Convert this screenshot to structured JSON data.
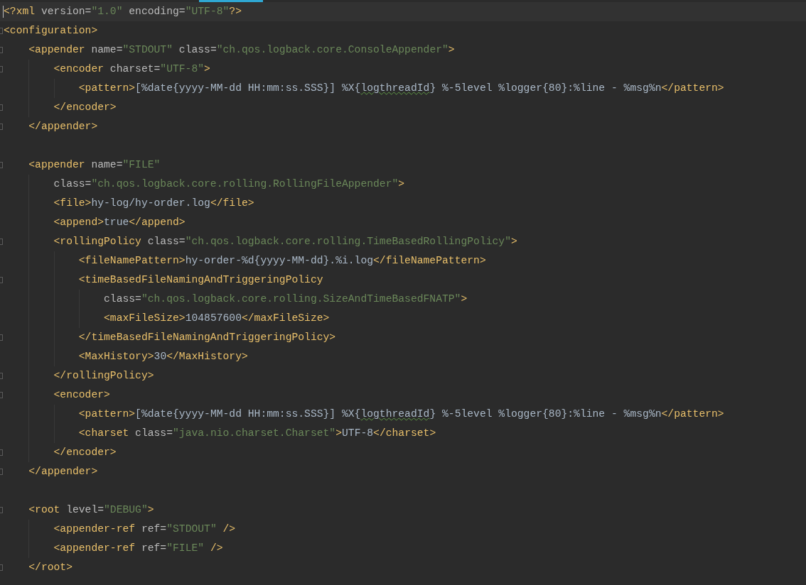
{
  "editor": {
    "lines": [
      {
        "current": true,
        "fold": false,
        "tokens": [
          {
            "kind": "tag",
            "text": "<?xml"
          },
          {
            "kind": "attr",
            "text": " version="
          },
          {
            "kind": "value",
            "text": "\"1.0\""
          },
          {
            "kind": "attr",
            "text": " encoding="
          },
          {
            "kind": "value",
            "text": "\"UTF-8\""
          },
          {
            "kind": "tag",
            "text": "?>"
          }
        ]
      },
      {
        "current": false,
        "fold": true,
        "tokens": [
          {
            "kind": "tag",
            "text": "<configuration>"
          }
        ]
      },
      {
        "current": false,
        "fold": true,
        "tokens": [
          {
            "kind": "tag",
            "text": "    <appender"
          },
          {
            "kind": "attr",
            "text": " name="
          },
          {
            "kind": "value",
            "text": "\"STDOUT\""
          },
          {
            "kind": "attr",
            "text": " class="
          },
          {
            "kind": "value",
            "text": "\"ch.qos.logback.core.ConsoleAppender\""
          },
          {
            "kind": "tag",
            "text": ">"
          }
        ]
      },
      {
        "current": false,
        "fold": true,
        "tokens": [
          {
            "kind": "tag",
            "text": "        <encoder"
          },
          {
            "kind": "attr",
            "text": " charset="
          },
          {
            "kind": "value",
            "text": "\"UTF-8\""
          },
          {
            "kind": "tag",
            "text": ">"
          }
        ]
      },
      {
        "current": false,
        "fold": false,
        "tokens": [
          {
            "kind": "tag",
            "text": "            <pattern>"
          },
          {
            "kind": "text",
            "text": "[%date{yyyy-MM-dd HH:mm:ss.SSS}] %X{"
          },
          {
            "kind": "typo",
            "text": "logthreadId"
          },
          {
            "kind": "text",
            "text": "} %-5level %logger{80}:%line - %msg%n"
          },
          {
            "kind": "tag",
            "text": "</pattern>"
          }
        ]
      },
      {
        "current": false,
        "fold": true,
        "tokens": [
          {
            "kind": "tag",
            "text": "        </encoder>"
          }
        ]
      },
      {
        "current": false,
        "fold": true,
        "tokens": [
          {
            "kind": "tag",
            "text": "    </appender>"
          }
        ]
      },
      {
        "current": false,
        "fold": false
      },
      {
        "current": false,
        "fold": true,
        "tokens": [
          {
            "kind": "tag",
            "text": "    <appender"
          },
          {
            "kind": "attr",
            "text": " name="
          },
          {
            "kind": "value",
            "text": "\"FILE\""
          }
        ]
      },
      {
        "current": false,
        "fold": false,
        "tokens": [
          {
            "kind": "attr",
            "text": "        class="
          },
          {
            "kind": "value",
            "text": "\"ch.qos.logback.core.rolling.RollingFileAppender\""
          },
          {
            "kind": "tag",
            "text": ">"
          }
        ]
      },
      {
        "current": false,
        "fold": false,
        "tokens": [
          {
            "kind": "tag",
            "text": "        <file>"
          },
          {
            "kind": "text",
            "text": "hy-log/hy-order.log"
          },
          {
            "kind": "tag",
            "text": "</file>"
          }
        ]
      },
      {
        "current": false,
        "fold": false,
        "tokens": [
          {
            "kind": "tag",
            "text": "        <append>"
          },
          {
            "kind": "text",
            "text": "true"
          },
          {
            "kind": "tag",
            "text": "</append>"
          }
        ]
      },
      {
        "current": false,
        "fold": true,
        "tokens": [
          {
            "kind": "tag",
            "text": "        <rollingPolicy"
          },
          {
            "kind": "attr",
            "text": " class="
          },
          {
            "kind": "value",
            "text": "\"ch.qos.logback.core.rolling.TimeBasedRollingPolicy\""
          },
          {
            "kind": "tag",
            "text": ">"
          }
        ]
      },
      {
        "current": false,
        "fold": false,
        "tokens": [
          {
            "kind": "tag",
            "text": "            <fileNamePattern>"
          },
          {
            "kind": "text",
            "text": "hy-order-%d{yyyy-MM-dd}.%i.log"
          },
          {
            "kind": "tag",
            "text": "</fileNamePattern>"
          }
        ]
      },
      {
        "current": false,
        "fold": true,
        "tokens": [
          {
            "kind": "tag",
            "text": "            <timeBasedFileNamingAndTriggeringPolicy"
          }
        ]
      },
      {
        "current": false,
        "fold": false,
        "tokens": [
          {
            "kind": "attr",
            "text": "                class="
          },
          {
            "kind": "value",
            "text": "\"ch.qos.logback.core.rolling.SizeAndTimeBasedFNATP\""
          },
          {
            "kind": "tag",
            "text": ">"
          }
        ]
      },
      {
        "current": false,
        "fold": false,
        "tokens": [
          {
            "kind": "tag",
            "text": "                <maxFileSize>"
          },
          {
            "kind": "text",
            "text": "104857600"
          },
          {
            "kind": "tag",
            "text": "</maxFileSize>"
          }
        ]
      },
      {
        "current": false,
        "fold": true,
        "tokens": [
          {
            "kind": "tag",
            "text": "            </timeBasedFileNamingAndTriggeringPolicy>"
          }
        ]
      },
      {
        "current": false,
        "fold": false,
        "tokens": [
          {
            "kind": "tag",
            "text": "            <MaxHistory>"
          },
          {
            "kind": "text",
            "text": "30"
          },
          {
            "kind": "tag",
            "text": "</MaxHistory>"
          }
        ]
      },
      {
        "current": false,
        "fold": true,
        "tokens": [
          {
            "kind": "tag",
            "text": "        </rollingPolicy>"
          }
        ]
      },
      {
        "current": false,
        "fold": true,
        "tokens": [
          {
            "kind": "tag",
            "text": "        <encoder>"
          }
        ]
      },
      {
        "current": false,
        "fold": false,
        "tokens": [
          {
            "kind": "tag",
            "text": "            <pattern>"
          },
          {
            "kind": "text",
            "text": "[%date{yyyy-MM-dd HH:mm:ss.SSS}] %X{"
          },
          {
            "kind": "typo",
            "text": "logthreadId"
          },
          {
            "kind": "text",
            "text": "} %-5level %logger{80}:%line - %msg%n"
          },
          {
            "kind": "tag",
            "text": "</pattern>"
          }
        ]
      },
      {
        "current": false,
        "fold": false,
        "tokens": [
          {
            "kind": "tag",
            "text": "            <charset"
          },
          {
            "kind": "attr",
            "text": " class="
          },
          {
            "kind": "value",
            "text": "\"java.nio.charset.Charset\""
          },
          {
            "kind": "tag",
            "text": ">"
          },
          {
            "kind": "text",
            "text": "UTF-8"
          },
          {
            "kind": "tag",
            "text": "</charset>"
          }
        ]
      },
      {
        "current": false,
        "fold": true,
        "tokens": [
          {
            "kind": "tag",
            "text": "        </encoder>"
          }
        ]
      },
      {
        "current": false,
        "fold": true,
        "tokens": [
          {
            "kind": "tag",
            "text": "    </appender>"
          }
        ]
      },
      {
        "current": false,
        "fold": false
      },
      {
        "current": false,
        "fold": true,
        "tokens": [
          {
            "kind": "tag",
            "text": "    <root"
          },
          {
            "kind": "attr",
            "text": " level="
          },
          {
            "kind": "value",
            "text": "\"DEBUG\""
          },
          {
            "kind": "tag",
            "text": ">"
          }
        ]
      },
      {
        "current": false,
        "fold": false,
        "tokens": [
          {
            "kind": "tag",
            "text": "        <appender-ref"
          },
          {
            "kind": "attr",
            "text": " ref="
          },
          {
            "kind": "value",
            "text": "\"STDOUT\""
          },
          {
            "kind": "tag",
            "text": " />"
          }
        ]
      },
      {
        "current": false,
        "fold": false,
        "tokens": [
          {
            "kind": "tag",
            "text": "        <appender-ref"
          },
          {
            "kind": "attr",
            "text": " ref="
          },
          {
            "kind": "value",
            "text": "\"FILE\""
          },
          {
            "kind": "tag",
            "text": " />"
          }
        ]
      },
      {
        "current": false,
        "fold": true,
        "tokens": [
          {
            "kind": "tag",
            "text": "    </root>"
          }
        ]
      }
    ]
  }
}
